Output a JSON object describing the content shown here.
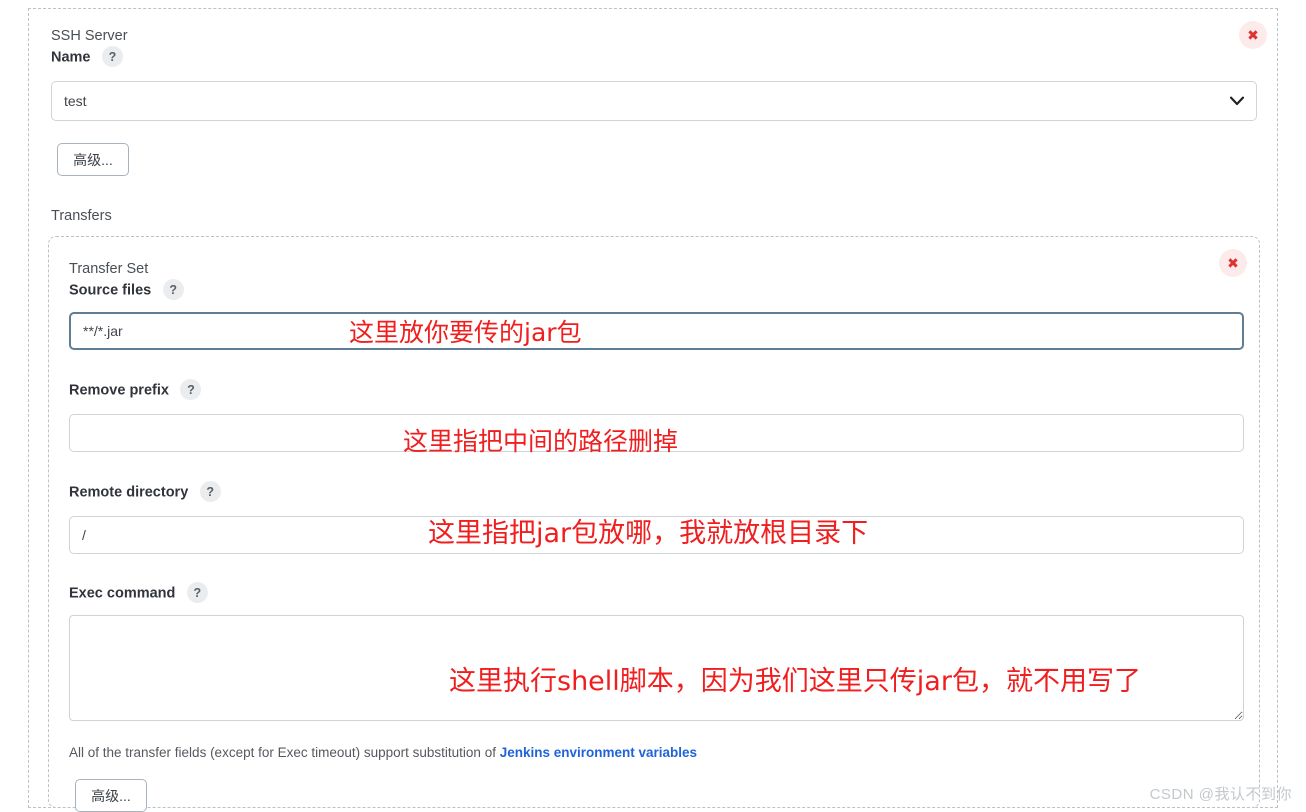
{
  "panel": {
    "ssh_server_title": "SSH Server",
    "name_label": "Name",
    "help_glyph": "?",
    "close_glyph": "✖",
    "selected_server": "test",
    "server_options": [
      "test"
    ],
    "advanced_top_label": "高级...",
    "transfers_label": "Transfers"
  },
  "transfer_set": {
    "title": "Transfer Set",
    "close_glyph": "✖",
    "source_files_label": "Source files",
    "source_files_value": "**/*.jar",
    "remove_prefix_label": "Remove prefix",
    "remove_prefix_value": "",
    "remote_directory_label": "Remote directory",
    "remote_directory_value": "/",
    "exec_command_label": "Exec command",
    "exec_command_value": "",
    "hint_prefix": "All of the transfer fields (except for Exec timeout) support substitution of ",
    "hint_link": "Jenkins environment variables",
    "advanced_bottom_label": "高级..."
  },
  "annotations": {
    "source_files": "这里放你要传的jar包",
    "remove_prefix": "这里指把中间的路径删掉",
    "remote_directory": "这里指把jar包放哪，我就放根目录下",
    "exec_command": "这里执行shell脚本，因为我们这里只传jar包，就不用写了"
  },
  "watermark": "CSDN @我认不到你",
  "colors": {
    "annotation_red": "#f01e1e",
    "link_blue": "#1f63d8",
    "dashed_border": "#b9c2cc",
    "focus_border": "#5f7d95",
    "close_bg": "#fdeaea",
    "close_fg": "#e03030"
  }
}
